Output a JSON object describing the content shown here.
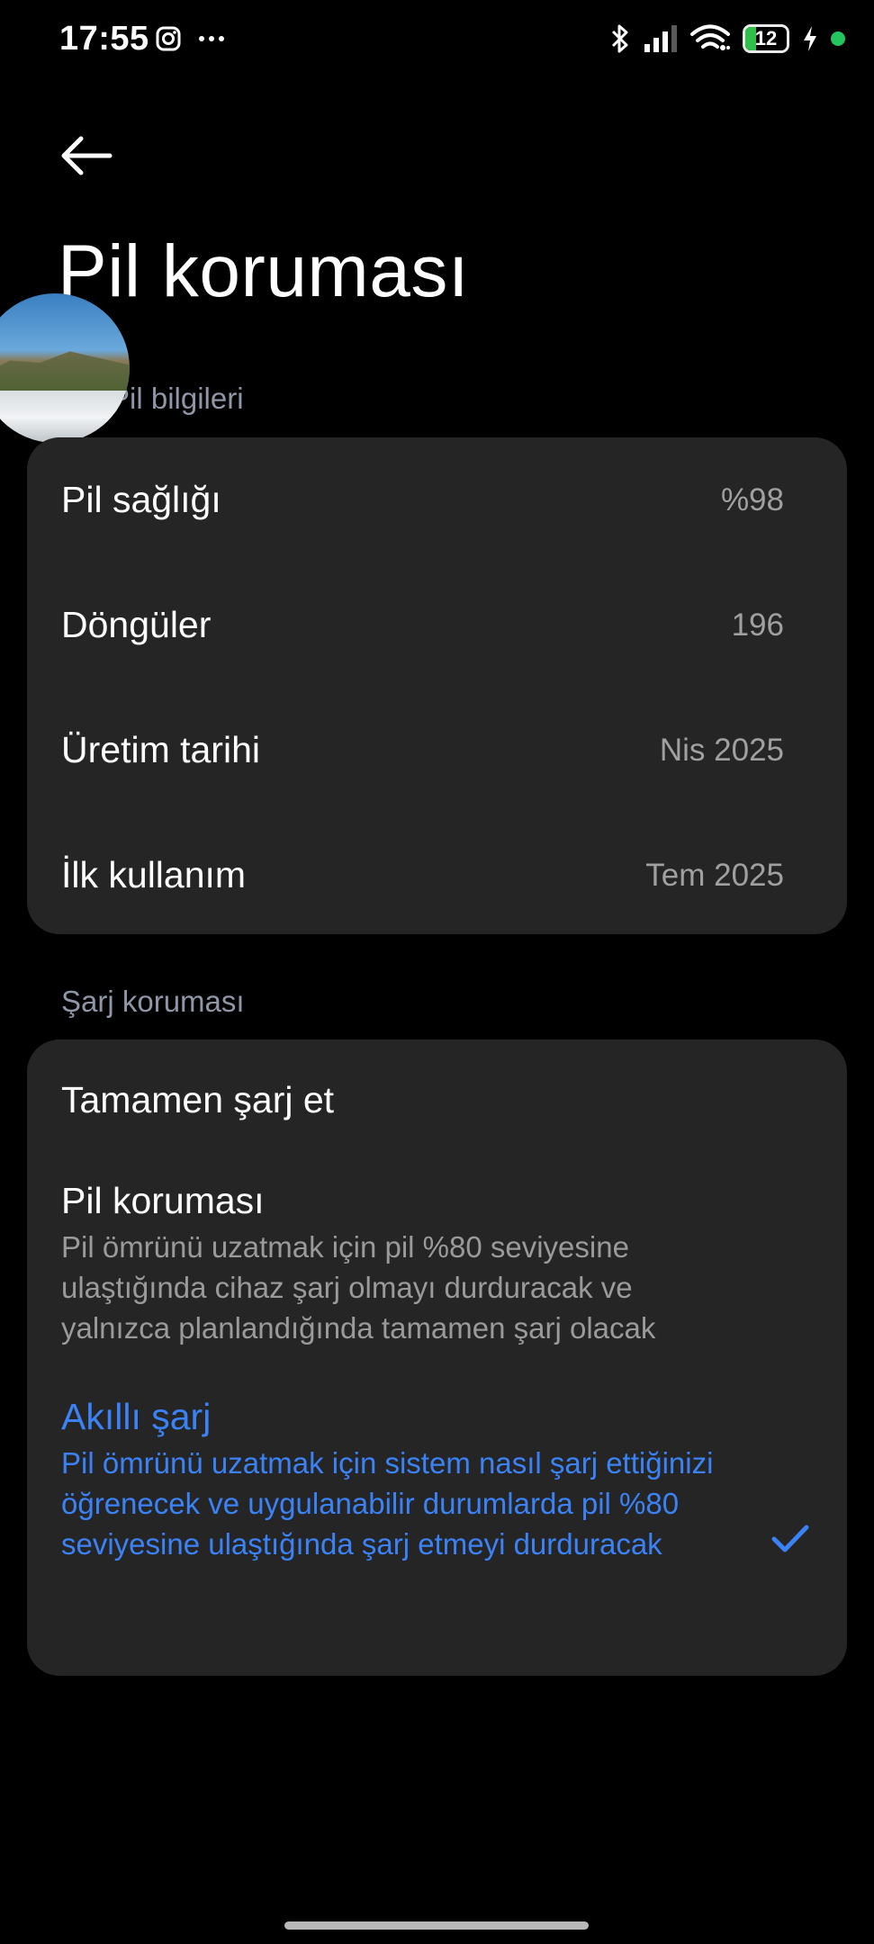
{
  "status_bar": {
    "time": "17:55",
    "battery_level": "12",
    "battery_fraction": 0.12,
    "left_icons": [
      "instagram-icon",
      "more-icon"
    ],
    "right_icons": [
      "bluetooth-icon",
      "signal-icon",
      "wifi-icon",
      "battery-icon",
      "charging-icon",
      "privacy-dot-icon"
    ],
    "colors": {
      "battery_fill": "#2fbf4a",
      "privacy_dot": "#22c55e"
    }
  },
  "header": {
    "back_icon": "back-arrow-icon",
    "title": "Pil koruması"
  },
  "battery_info": {
    "section_label": "Pil bilgileri",
    "rows": [
      {
        "label": "Pil sağlığı",
        "value": "%98"
      },
      {
        "label": "Döngüler",
        "value": "196"
      },
      {
        "label": "Üretim tarihi",
        "value": "Nis 2025"
      },
      {
        "label": "İlk kullanım",
        "value": "Tem 2025"
      }
    ]
  },
  "charge_protection": {
    "section_label": "Şarj koruması",
    "options": [
      {
        "title": "Tamamen şarj et",
        "description": "",
        "selected": false
      },
      {
        "title": "Pil koruması",
        "description": "Pil ömrünü uzatmak için pil %80 seviyesine ulaştığında cihaz şarj olmayı durduracak ve yalnızca planlandığında tamamen şarj olacak",
        "selected": false
      },
      {
        "title": "Akıllı şarj",
        "description": "Pil ömrünü uzatmak için sistem nasıl şarj ettiğinizi öğrenecek ve uygulanabilir durumlarda pil %80 seviyesine ulaştığında şarj etmeyi durduracak",
        "selected": true
      }
    ],
    "accent_color": "#3b82f6",
    "check_icon": "checkmark-icon"
  }
}
